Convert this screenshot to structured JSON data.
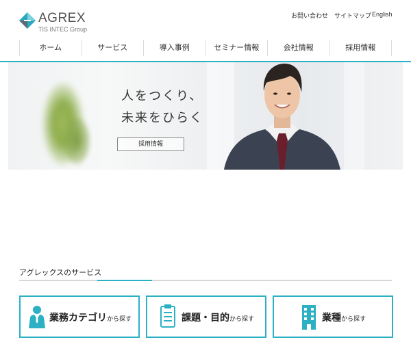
{
  "header": {
    "logo_text": "AGREX",
    "logo_sub": "TIS INTEC Group",
    "utility_links": [
      "お問い合わせ",
      "サイトマップ",
      "English"
    ]
  },
  "nav": {
    "items": [
      "ホーム",
      "サービス",
      "導入事例",
      "セミナー情報",
      "会社情報",
      "採用情報"
    ]
  },
  "hero": {
    "line1": "人をつくり、",
    "line2": "未来をひらく",
    "button": "採用情報"
  },
  "services": {
    "title": "アグレックスのサービス",
    "cards": [
      {
        "main": "業務カテゴリ",
        "sub": "から探す",
        "icon": "person-icon"
      },
      {
        "main": "課題・目的",
        "sub": "から探す",
        "icon": "clipboard-icon"
      },
      {
        "main": "業種",
        "sub": "から探す",
        "icon": "building-icon"
      }
    ]
  },
  "colors": {
    "accent": "#2cb1c4",
    "text": "#333333"
  }
}
